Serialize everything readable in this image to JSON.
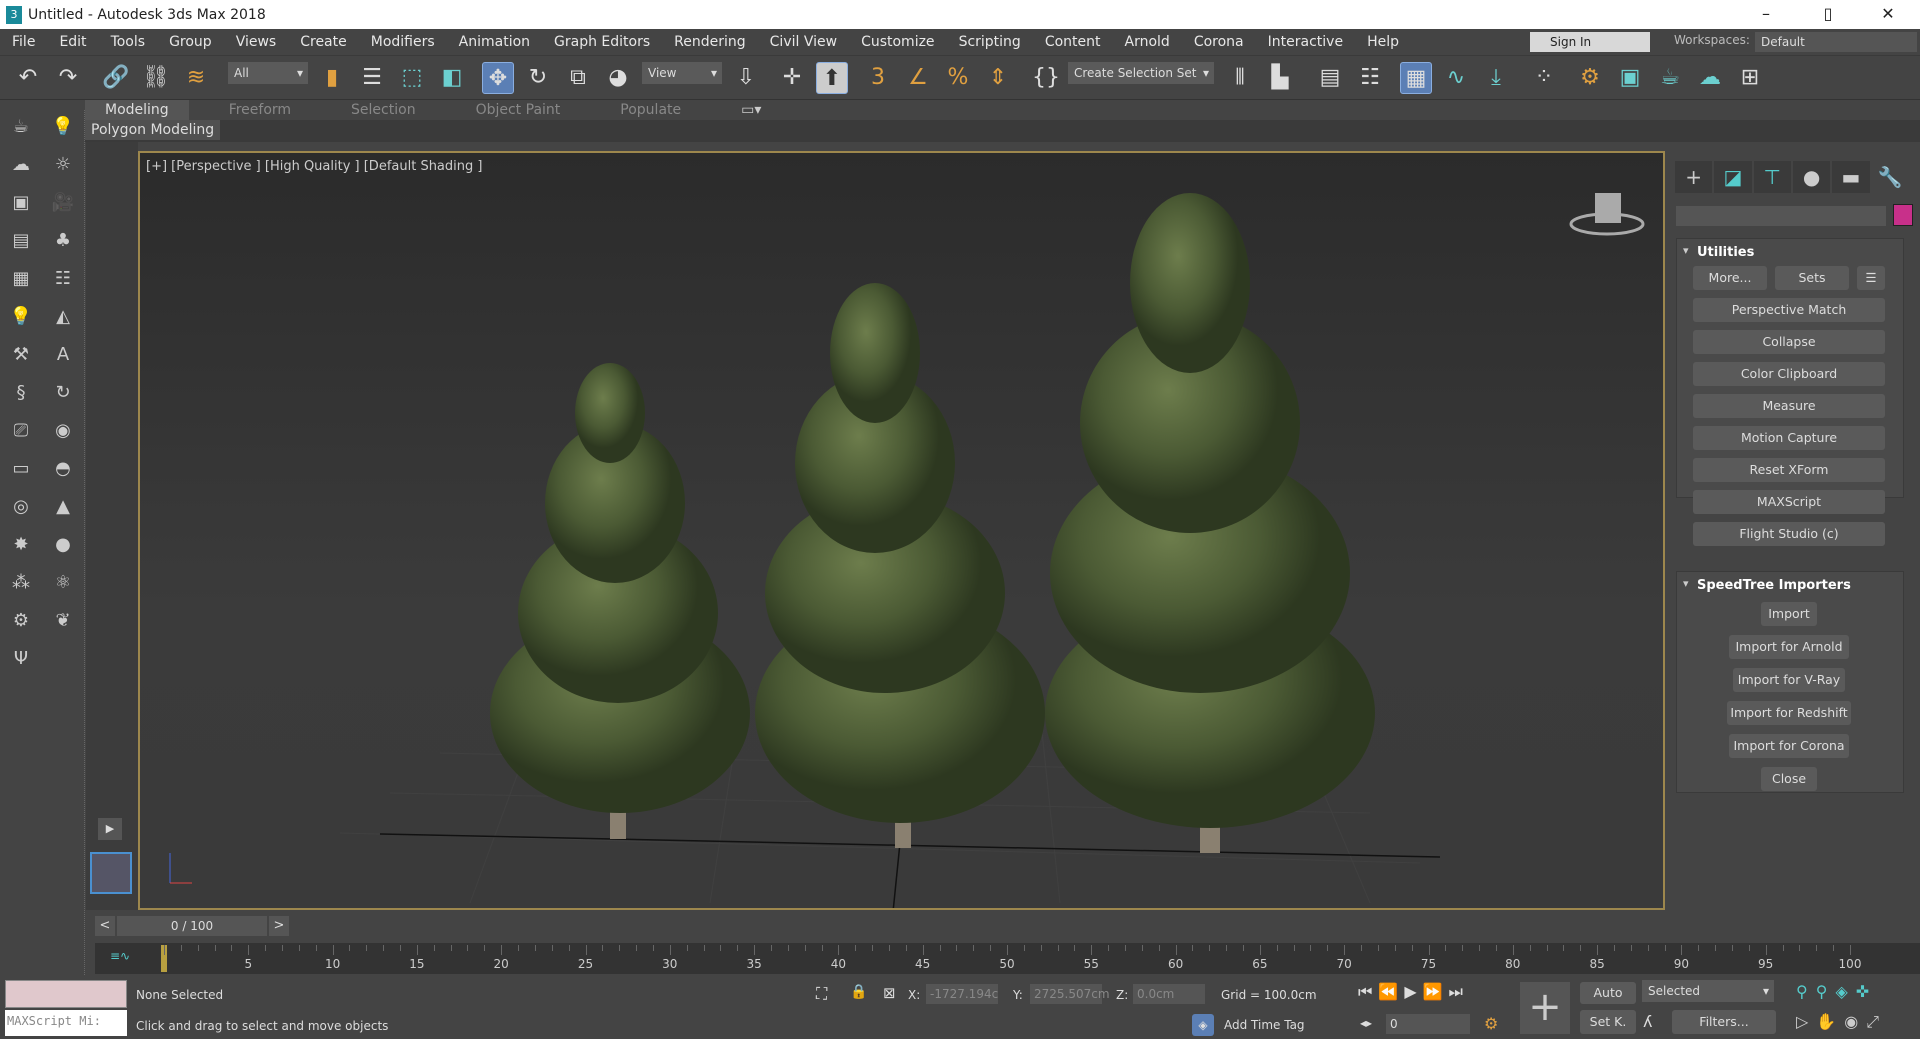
{
  "window": {
    "title": "Untitled - Autodesk 3ds Max 2018",
    "logo": "3",
    "minimize": "–",
    "maximize": "▯",
    "close": "✕"
  },
  "menu": [
    "File",
    "Edit",
    "Tools",
    "Group",
    "Views",
    "Create",
    "Modifiers",
    "Animation",
    "Graph Editors",
    "Rendering",
    "Civil View",
    "Customize",
    "Scripting",
    "Content",
    "Arnold",
    "Corona",
    "Interactive",
    "Help"
  ],
  "signin": "Sign In",
  "workspaces_label": "Workspaces:",
  "workspace": "Default",
  "toolbar": {
    "filter": "All",
    "ref_coord": "View",
    "selection_set": "Create Selection Set"
  },
  "ribbon": {
    "tabs": [
      "Modeling",
      "Freeform",
      "Selection",
      "Object Paint",
      "Populate"
    ],
    "panel": "Polygon Modeling"
  },
  "viewport": {
    "label": "[+] [Perspective ] [High Quality ] [Default Shading ]"
  },
  "utilities": {
    "title": "Utilities",
    "more": "More...",
    "sets": "Sets",
    "buttons": [
      "Perspective Match",
      "Collapse",
      "Color Clipboard",
      "Measure",
      "Motion Capture",
      "Reset XForm",
      "MAXScript",
      "Flight Studio (c)"
    ]
  },
  "speedtree": {
    "title": "SpeedTree Importers",
    "buttons": [
      "Import",
      "Import for Arnold",
      "Import for V-Ray",
      "Import for Redshift",
      "Import for Corona",
      "Close"
    ]
  },
  "colors": {
    "object": "#c8308a",
    "accent": "#5b7fb5",
    "viewport_border": "#9d874d"
  },
  "timeslider": {
    "frame": "0 / 100",
    "prev": "<",
    "next": ">"
  },
  "timeline": {
    "start": 0,
    "end": 100,
    "step": 5
  },
  "status": {
    "selection": "None Selected",
    "prompt": "Click and drag to select and move objects",
    "maxscript": "MAXScript Mi:",
    "x_label": "X:",
    "x": "-1727.194c",
    "y_label": "Y:",
    "y": "2725.507cm",
    "z_label": "Z:",
    "z": "0.0cm",
    "grid": "Grid = 100.0cm",
    "add_time_tag": "Add Time Tag",
    "auto": "Auto",
    "set_key": "Set K.",
    "key_mode": "Selected",
    "filters": "Filters...",
    "frame": "0"
  }
}
